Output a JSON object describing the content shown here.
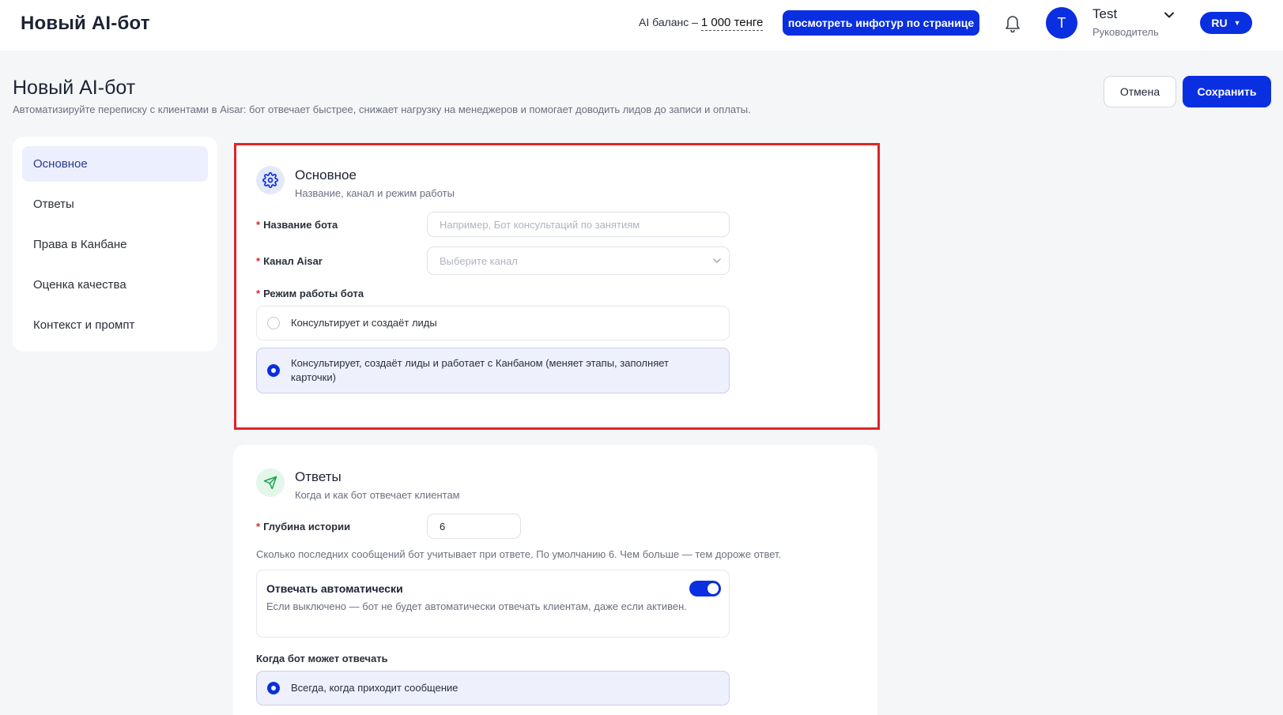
{
  "colors": {
    "primary": "#0a2fe0",
    "highlight_border": "#e02424",
    "required": "#e02424",
    "active_nav_bg": "#eceffd"
  },
  "header": {
    "logo": "Новый AI-бот",
    "balance_label": "AI баланс – ",
    "balance_amount": "1 000 тенге",
    "tour_button": "посмотреть инфотур по странице",
    "bell_icon": "bell-icon",
    "user": {
      "avatar_letter": "T",
      "name": "Test",
      "role": "Руководитель"
    },
    "language": "RU"
  },
  "page": {
    "title": "Новый AI-бот",
    "subtitle": "Автоматизируйте переписку с клиентами в Aisar: бот отвечает быстрее, снижает нагрузку на менеджеров и помогает доводить лидов до записи и оплаты.",
    "cancel_button": "Отмена",
    "save_button": "Сохранить"
  },
  "sidebar": {
    "items": [
      {
        "label": "Основное",
        "active": true
      },
      {
        "label": "Ответы",
        "active": false
      },
      {
        "label": "Права в Канбане",
        "active": false
      },
      {
        "label": "Оценка качества",
        "active": false
      },
      {
        "label": "Контекст и промпт",
        "active": false
      }
    ]
  },
  "basic": {
    "icon": "gear-icon",
    "title": "Основное",
    "description": "Название, канал и режим работы",
    "required_mark": "*",
    "bot_name_label": "Название бота",
    "bot_name_value": "",
    "bot_name_placeholder": "Например, Бот консультаций по занятиям",
    "channel_label": "Канал Aisar",
    "channel_placeholder": "Выберите канал",
    "mode_label": "Режим работы бота",
    "mode_options": [
      {
        "label": "Консультирует и создаёт лиды",
        "selected": false
      },
      {
        "label": "Консультирует, создаёт лиды и работает с Канбаном (меняет этапы, заполняет карточки)",
        "selected": true
      }
    ]
  },
  "answers": {
    "icon": "send-icon",
    "title": "Ответы",
    "description": "Когда и как бот отвечает клиентам",
    "history_label": "Глубина истории",
    "history_value": "6",
    "history_hint": "Сколько последних сообщений бот учитывает при ответе. По умолчанию 6. Чем больше — тем дороже ответ.",
    "auto_reply_title": "Отвечать автоматически",
    "auto_reply_desc": "Если выключено — бот не будет автоматически отвечать клиентам, даже если активен.",
    "auto_reply_on": true,
    "when_label": "Когда бот может отвечать",
    "when_options": [
      {
        "label": "Всегда, когда приходит сообщение",
        "selected": true
      }
    ]
  }
}
